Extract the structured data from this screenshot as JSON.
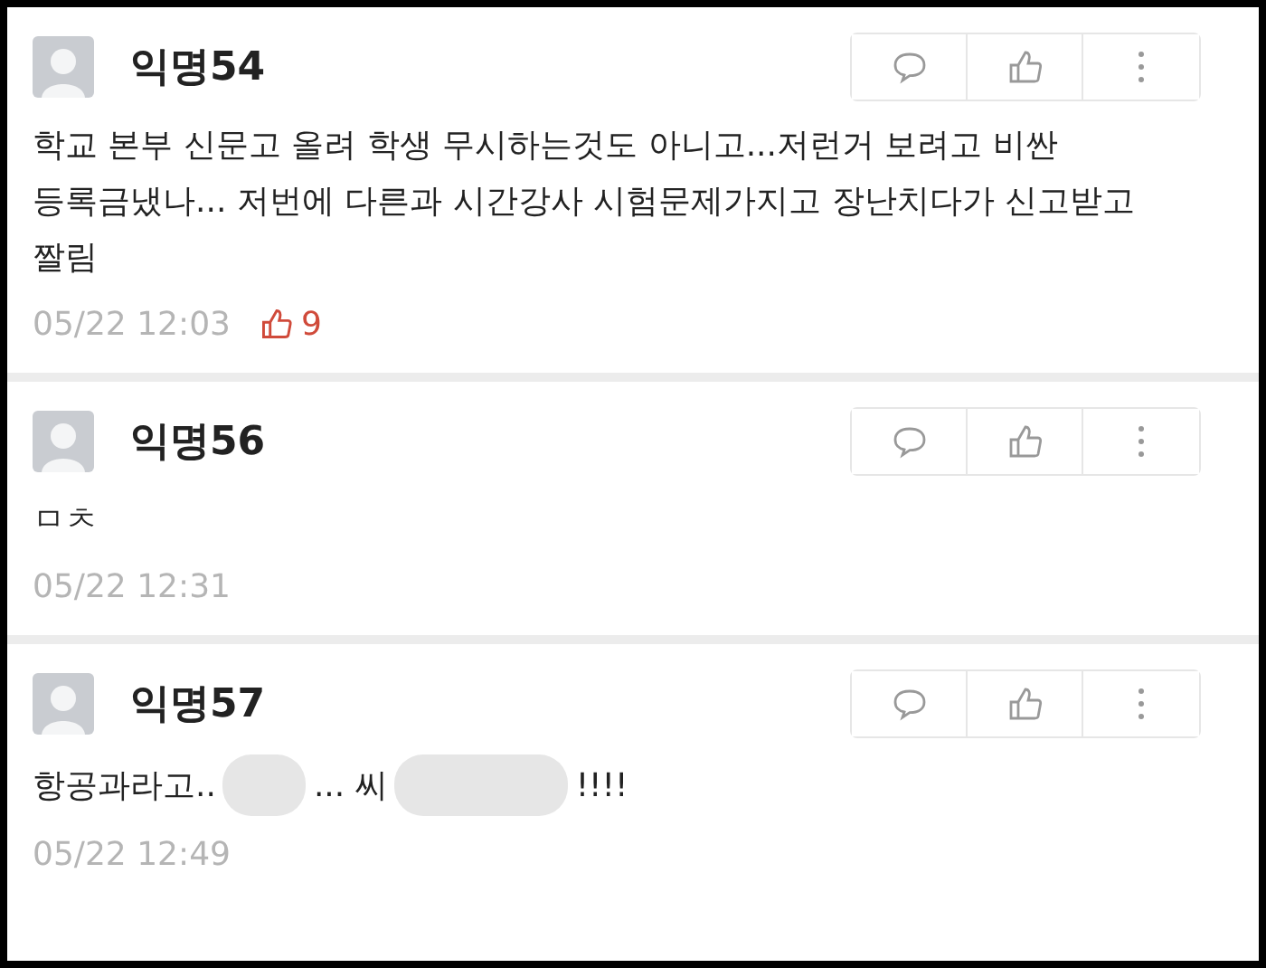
{
  "comments": [
    {
      "author": "익명54",
      "body": [
        {
          "kind": "text",
          "text": "학교 본부 신문고 올려 학생 무시하는것도 아니고...저런거 보려고 비싼 등록금냈나... 저번에 다른과 시간강사 시험문제가지고 장난치다가 신고받고 짤림"
        }
      ],
      "time": "05/22 12:03",
      "likes": "9"
    },
    {
      "author": "익명56",
      "body": [
        {
          "kind": "text",
          "text": "ㅁㅊ"
        }
      ],
      "time": "05/22 12:31"
    },
    {
      "author": "익명57",
      "body": [
        {
          "kind": "text",
          "text": "항공과라고.."
        },
        {
          "kind": "redaction"
        },
        {
          "kind": "text",
          "text": "... 씨"
        },
        {
          "kind": "redaction",
          "wide": true
        },
        {
          "kind": "text",
          "text": "!!!!"
        }
      ],
      "time": "05/22 12:49"
    }
  ]
}
